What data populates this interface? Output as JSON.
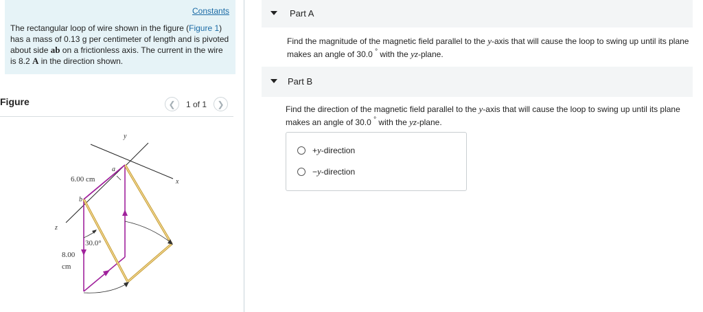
{
  "constants_link": "Constants",
  "problem": {
    "text1": "The rectangular loop of wire shown in the figure (",
    "figure_link": "Figure 1",
    "text2": ") has a mass of 0.13 g per centimeter of length and is pivoted about side ",
    "side": "ab",
    "text3": " on a frictionless axis. The current in the wire is 8.2 ",
    "unit": "A",
    "text4": " in the direction shown."
  },
  "figure_panel": {
    "title": "Figure",
    "pager": "1 of 1",
    "prev_icon": "chevron-left-icon",
    "next_icon": "chevron-right-icon",
    "labels": {
      "y": "y",
      "x": "x",
      "z": "z",
      "a": "a",
      "b": "b",
      "width": "6.00 cm",
      "angle": "30.0°",
      "height_value": "8.00",
      "height_unit": "cm"
    }
  },
  "part_a": {
    "title": "Part A",
    "question_1": "Find the magnitude of the magnetic field parallel to the ",
    "axis": "y",
    "question_2": "-axis that will cause the loop to swing up until its plane makes an angle of 30.0 ",
    "degree": "°",
    "question_3": " with the ",
    "plane": "yz",
    "question_4": "-plane."
  },
  "part_b": {
    "title": "Part B",
    "question_1": "Find the direction of the magnetic field parallel to the ",
    "axis": "y",
    "question_2": "-axis that will cause the loop to swing up until its plane makes an angle of 30.0 ",
    "degree": "°",
    "question_3": " with the ",
    "plane": "yz",
    "question_4": "-plane.",
    "options": [
      {
        "sign": "+",
        "var": "y",
        "label": "-direction"
      },
      {
        "sign": "−",
        "var": "y",
        "label": "-direction"
      }
    ]
  },
  "colors": {
    "loop_original": "#a0219c",
    "loop_swung": "#d8b24a",
    "link": "#1a6aa5",
    "intro_bg": "#e6f3f7"
  }
}
